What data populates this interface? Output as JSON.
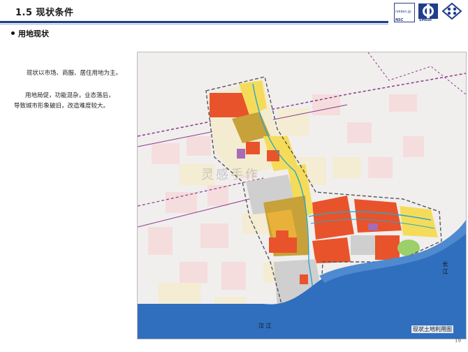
{
  "header": {
    "title": "1.5 现状条件",
    "logos": {
      "logo1_text": "nikken.jp",
      "logo1_caption": "NSC",
      "logo2_caption": "SMEDI"
    }
  },
  "section": {
    "heading": "用地现状",
    "paragraph1": "现状以市场、商服、居住用地为主。",
    "paragraph2_line1": "用地局促，功能混杂，业态落后，",
    "paragraph2_line2": "导致城市形象破旧，改造难度较大。"
  },
  "map": {
    "caption": "现状土地利用图",
    "river_label_left": "汉 江",
    "river_label_right": "长 江",
    "watermark": "灵感手作",
    "colors": {
      "water": "#2f6fbd",
      "commercial": "#e8532b",
      "residential": "#f4dc5a",
      "mixed": "#c7a23a",
      "pink": "#f5c6c6",
      "cream": "#f3ecd0",
      "gray": "#cfcfcf",
      "purple": "#a86bb5",
      "green": "#9bd06a"
    }
  },
  "footer": {
    "page_number": "19"
  }
}
